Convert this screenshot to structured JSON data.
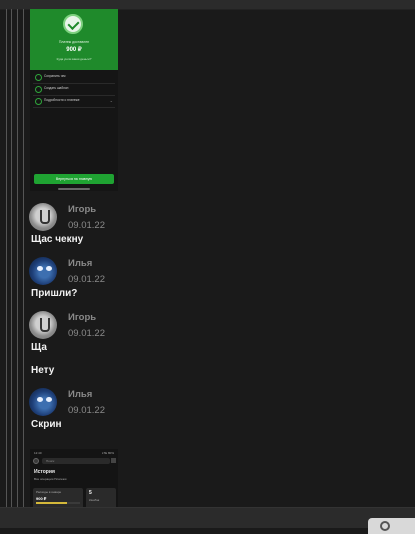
{
  "thread_images": [
    {
      "success_title": "Платеж доставлен",
      "amount": "900 ₽",
      "subtitle": "Куда ушли ваши деньги?",
      "actions": [
        "Сохранить чек",
        "Создать шаблон",
        "Подробности о платеже"
      ],
      "button": "Вернуться на главную"
    },
    {
      "status_left": "12:40",
      "status_right": "LTE 80%",
      "search_placeholder": "Поиск",
      "title": "История",
      "tabs": "Все операции   Платежи",
      "card1_label": "Расходы в январе",
      "card1_value": "900 ₽",
      "card2_value": "5",
      "card2_label": "Кэшбэк"
    }
  ],
  "messages": [
    {
      "author": "Игорь",
      "date": "09.01.22",
      "text": "Щас чекну",
      "avatar": "igor-avatar"
    },
    {
      "author": "Илья",
      "date": "09.01.22",
      "text": "Пришли?",
      "avatar": "ilya-avatar"
    },
    {
      "author": "Игорь",
      "date": "09.01.22",
      "text": "Ща",
      "avatar": "igor-avatar"
    },
    {
      "author": "",
      "date": "",
      "text": "Нету",
      "avatar": ""
    },
    {
      "author": "Илья",
      "date": "09.01.22",
      "text": "Скрин",
      "avatar": "ilya-avatar"
    }
  ],
  "colors": {
    "background": "#1a1a1a",
    "success_green": "#1f8a2b",
    "author_gray": "#8a8a8a",
    "text_white": "#f2f2f2"
  }
}
